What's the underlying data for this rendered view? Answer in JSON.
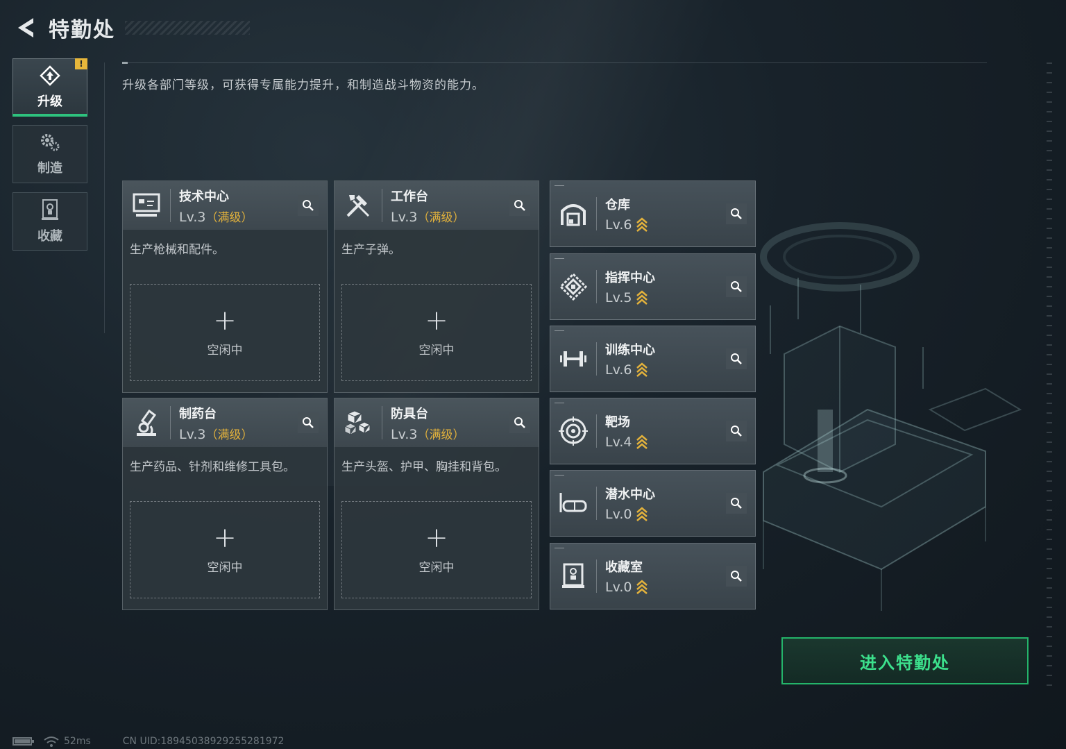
{
  "header": {
    "title": "特勤处"
  },
  "sidebar": {
    "tabs": [
      {
        "label": "升级",
        "icon": "upgrade-icon",
        "active": true,
        "badge": "!"
      },
      {
        "label": "制造",
        "icon": "gears-icon",
        "active": false
      },
      {
        "label": "收藏",
        "icon": "trophy-icon",
        "active": false
      }
    ]
  },
  "intro": "升级各部门等级，可获得专属能力提升，和制造战斗物资的能力。",
  "departments": [
    {
      "name": "技术中心",
      "level": "Lv.3",
      "max": "（满级）",
      "desc": "生产枪械和配件。",
      "plus": "+",
      "status": "空闲中",
      "icon": "computer-icon"
    },
    {
      "name": "工作台",
      "level": "Lv.3",
      "max": "（满级）",
      "desc": "生产子弹。",
      "plus": "+",
      "status": "空闲中",
      "icon": "tools-icon"
    },
    {
      "name": "制药台",
      "level": "Lv.3",
      "max": "（满级）",
      "desc": "生产药品、针剂和维修工具包。",
      "plus": "+",
      "status": "空闲中",
      "icon": "microscope-icon"
    },
    {
      "name": "防具台",
      "level": "Lv.3",
      "max": "（满级）",
      "desc": "生产头盔、护甲、胸挂和背包。",
      "plus": "+",
      "status": "空闲中",
      "icon": "cubes-icon"
    }
  ],
  "facilities": [
    {
      "name": "仓库",
      "level": "Lv.6",
      "icon": "warehouse-icon"
    },
    {
      "name": "指挥中心",
      "level": "Lv.5",
      "icon": "command-icon"
    },
    {
      "name": "训练中心",
      "level": "Lv.6",
      "icon": "dumbbell-icon"
    },
    {
      "name": "靶场",
      "level": "Lv.4",
      "icon": "target-icon"
    },
    {
      "name": "潜水中心",
      "level": "Lv.0",
      "icon": "goggles-icon"
    },
    {
      "name": "收藏室",
      "level": "Lv.0",
      "icon": "trophy-cabinet-icon"
    }
  ],
  "enter_button": "进入特勤处",
  "status_bar": {
    "ping": "52ms",
    "uid": "CN UID:18945038929255281972"
  },
  "colors": {
    "accent_green": "#2ec27e",
    "max_gold": "#e3b23c",
    "badge_yellow": "#e7b73b"
  }
}
